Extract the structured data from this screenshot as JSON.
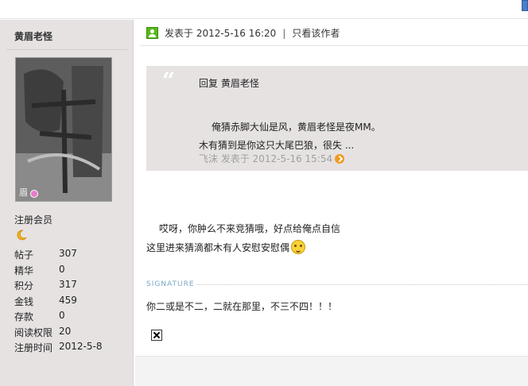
{
  "author": {
    "name": "黄眉老怪",
    "avatar_tag": "眉",
    "role": "注册会员",
    "stats": [
      {
        "key": "帖子",
        "value": "307"
      },
      {
        "key": "精华",
        "value": "0"
      },
      {
        "key": "积分",
        "value": "317"
      },
      {
        "key": "金钱",
        "value": "459"
      },
      {
        "key": "存款",
        "value": "0"
      },
      {
        "key": "阅读权限",
        "value": "20"
      },
      {
        "key": "注册时间",
        "value": "2012-5-8"
      }
    ]
  },
  "post": {
    "posted_at": "发表于 2012-5-16 16:20",
    "separator": "|",
    "only_author_link": "只看该作者",
    "quote": {
      "mark": "“",
      "reply_line": "回复  黄眉老怪",
      "line1": "俺猜赤脚大仙是风，黄眉老怪是夜MM。",
      "line2": "木有猜到是你这只大尾巴狼，很失 ...",
      "meta": "飞沫 发表于 2012-5-16 15:54"
    },
    "body_line1": "哎呀，你肿么不来竞猜哦，好点给俺点自信",
    "body_line2": "这里进来猜滴都木有人安慰安慰偶",
    "signature_label": "SIGNATURE",
    "signature_text": "你二或是不二，二就在那里，不三不四！！！"
  },
  "icons": {
    "online": "user-online-icon",
    "goto": "goto-post-icon",
    "smiley": "smiley-icon",
    "broken_image": "broken-image-icon",
    "moon": "moon-rank-icon"
  },
  "colors": {
    "sidebar_bg": "#e6e2e2",
    "quote_bg": "#e6e2e2",
    "meta_gray": "#a0a0a0",
    "signature_blue": "#7aa7c7"
  }
}
